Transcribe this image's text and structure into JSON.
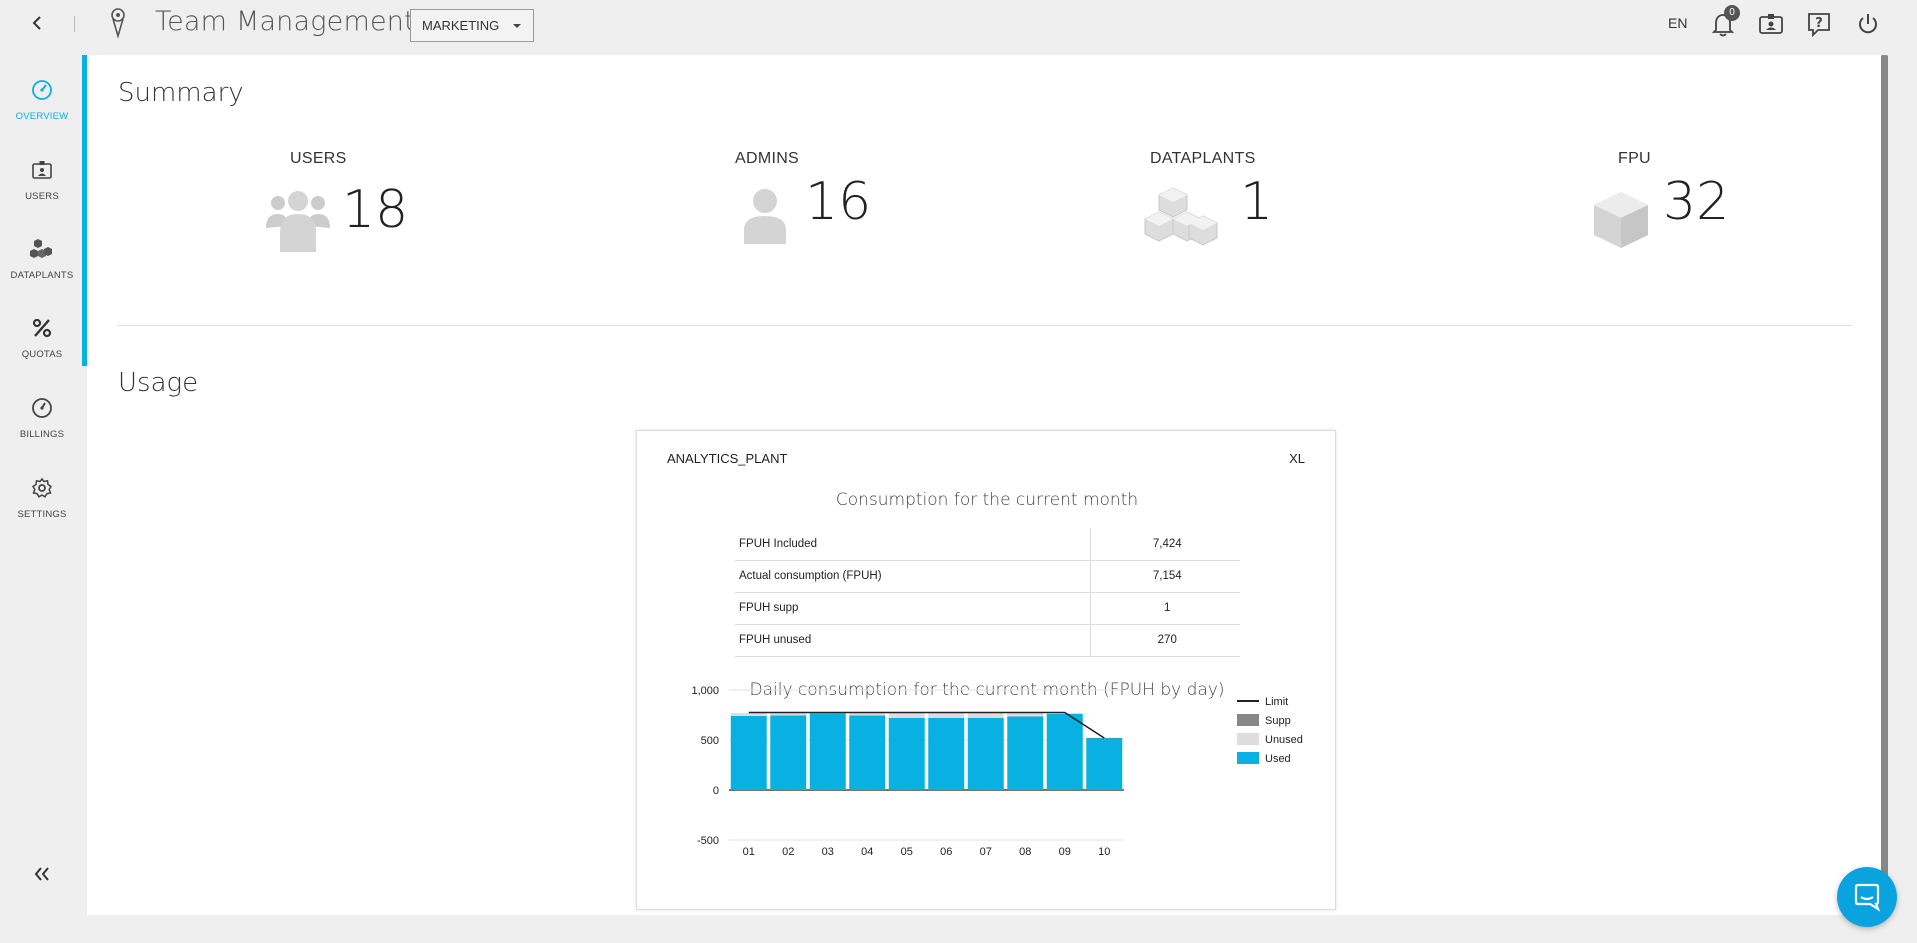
{
  "header": {
    "title": "Team Management",
    "team_select": "MARKETING",
    "language": "EN",
    "notification_count": "0"
  },
  "sidebar": {
    "items": [
      {
        "label": "OVERVIEW",
        "icon": "gauge-icon",
        "active": true
      },
      {
        "label": "USERS",
        "icon": "user-card-icon"
      },
      {
        "label": "DATAPLANTS",
        "icon": "cubes-icon"
      },
      {
        "label": "QUOTAS",
        "icon": "percent-icon"
      },
      {
        "label": "BILLINGS",
        "icon": "billing-gauge-icon"
      },
      {
        "label": "SETTINGS",
        "icon": "gear-icon"
      }
    ]
  },
  "summary": {
    "title": "Summary",
    "stats": [
      {
        "label": "USERS",
        "value": "18",
        "icon": "users-group-icon"
      },
      {
        "label": "ADMINS",
        "value": "16",
        "icon": "admin-user-icon"
      },
      {
        "label": "DATAPLANTS",
        "value": "1",
        "icon": "cubes-icon"
      },
      {
        "label": "FPU",
        "value": "32",
        "icon": "cube-icon"
      }
    ]
  },
  "usage": {
    "title": "Usage",
    "card": {
      "name": "ANALYTICS_PLANT",
      "size": "XL",
      "consumption_title": "Consumption for the current month",
      "table": [
        {
          "label": "FPUH Included",
          "value": "7,424"
        },
        {
          "label": "Actual consumption (FPUH)",
          "value": "7,154"
        },
        {
          "label": "FPUH supp",
          "value": "1"
        },
        {
          "label": "FPUH unused",
          "value": "270"
        }
      ],
      "daily_title": "Daily consumption for the current month (FPUH by day)"
    }
  },
  "colors": {
    "accent": "#08b1e2",
    "used": "#08b1e2",
    "unused": "#dddddd",
    "supp": "#888888",
    "limit": "#222222"
  },
  "chart_data": {
    "type": "bar",
    "categories": [
      "01",
      "02",
      "03",
      "04",
      "05",
      "06",
      "07",
      "08",
      "09",
      "10"
    ],
    "series": [
      {
        "name": "Used",
        "values": [
          740,
          745,
          765,
          745,
          720,
          720,
          720,
          735,
          760,
          520
        ]
      },
      {
        "name": "Unused",
        "values": [
          30,
          25,
          5,
          25,
          50,
          50,
          50,
          35,
          10,
          0
        ]
      },
      {
        "name": "Supp",
        "values": [
          0,
          0,
          0,
          0,
          0,
          0,
          0,
          0,
          0,
          1
        ]
      }
    ],
    "limit": [
      775,
      775,
      775,
      775,
      775,
      775,
      775,
      775,
      775,
      520
    ],
    "legend": [
      "Limit",
      "Supp",
      "Unused",
      "Used"
    ],
    "ylim": [
      -500,
      1000
    ],
    "yticks": [
      "1,000",
      "500",
      "0",
      "-500"
    ],
    "legend_position": "right"
  }
}
